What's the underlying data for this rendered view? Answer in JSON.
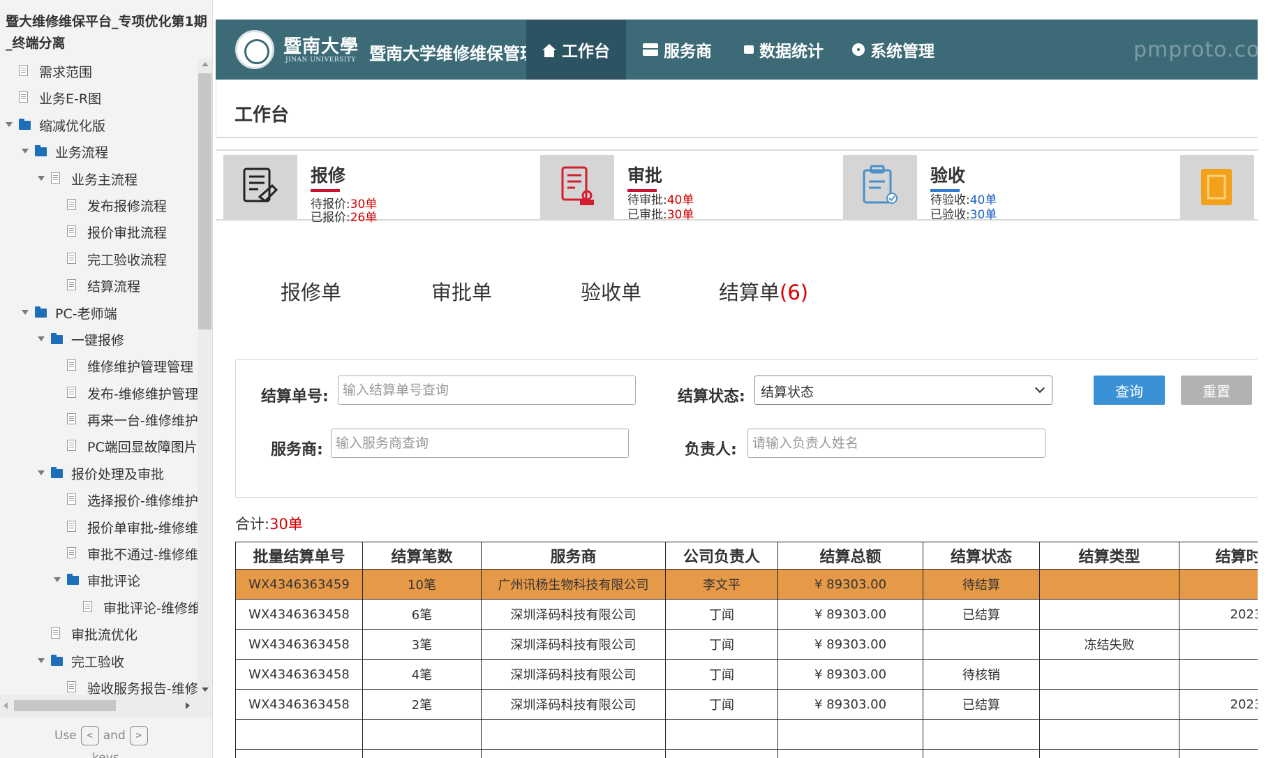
{
  "sidebar": {
    "title": "暨大维修维保平台_专项优化第1期_终端分离",
    "tree": [
      {
        "label": "需求范围",
        "type": "page",
        "level": 0,
        "toggle": false
      },
      {
        "label": "业务E-R图",
        "type": "page",
        "level": 0,
        "toggle": false
      },
      {
        "label": "缩减优化版",
        "type": "folder",
        "level": 0,
        "toggle": true
      },
      {
        "label": "业务流程",
        "type": "folder",
        "level": 1,
        "toggle": true
      },
      {
        "label": "业务主流程",
        "type": "page",
        "level": 2,
        "toggle": true
      },
      {
        "label": "发布报修流程",
        "type": "page",
        "level": 3,
        "toggle": false
      },
      {
        "label": "报价审批流程",
        "type": "page",
        "level": 3,
        "toggle": false
      },
      {
        "label": "完工验收流程",
        "type": "page",
        "level": 3,
        "toggle": false
      },
      {
        "label": "结算流程",
        "type": "page",
        "level": 3,
        "toggle": false
      },
      {
        "label": "PC-老师端",
        "type": "folder",
        "level": 1,
        "toggle": true
      },
      {
        "label": "一键报修",
        "type": "folder",
        "level": 2,
        "toggle": true
      },
      {
        "label": "维修维护管理管理",
        "type": "page",
        "level": 3,
        "toggle": false
      },
      {
        "label": "发布-维修维护管理",
        "type": "page",
        "level": 3,
        "toggle": false
      },
      {
        "label": "再来一台-维修维护",
        "type": "page",
        "level": 3,
        "toggle": false
      },
      {
        "label": "PC端回显故障图片",
        "type": "page",
        "level": 3,
        "toggle": false
      },
      {
        "label": "报价处理及审批",
        "type": "folder",
        "level": 2,
        "toggle": true
      },
      {
        "label": "选择报价-维修维护",
        "type": "page",
        "level": 3,
        "toggle": false
      },
      {
        "label": "报价单审批-维修维护",
        "type": "page",
        "level": 3,
        "toggle": false
      },
      {
        "label": "审批不通过-维修维护",
        "type": "page",
        "level": 3,
        "toggle": false
      },
      {
        "label": "审批评论",
        "type": "folder",
        "level": 3,
        "toggle": true
      },
      {
        "label": "审批评论-维修维护",
        "type": "page",
        "level": 4,
        "toggle": false
      },
      {
        "label": "审批流优化",
        "type": "page",
        "level": 2,
        "toggle": false
      },
      {
        "label": "完工验收",
        "type": "folder",
        "level": 2,
        "toggle": true
      },
      {
        "label": "验收服务报告-维修维护",
        "type": "page",
        "level": 3,
        "toggle": false
      }
    ],
    "hint_use": "Use",
    "hint_and": "and",
    "hint_key_left": "<",
    "hint_key_right": ">",
    "hint_keys": "keys"
  },
  "header": {
    "logo_cn": "暨南大學",
    "logo_en": "JINAN UNIVERSITY",
    "app_title": "暨南大学维修维保管理平台",
    "watermark": "pmproto.com 产品原型素材网站",
    "nav": [
      {
        "label": "工作台",
        "icon": "home-icon",
        "active": true
      },
      {
        "label": "服务商",
        "icon": "store-icon",
        "active": false
      },
      {
        "label": "数据统计",
        "icon": "chart-icon",
        "active": false
      },
      {
        "label": "系统管理",
        "icon": "gear-icon",
        "active": false
      }
    ]
  },
  "page_title": "工作台",
  "stats": [
    {
      "title": "报修",
      "icon": "repair-form-icon",
      "line1_label": "待报价:",
      "line1_value": "30单",
      "line2_label": "已报价:",
      "line2_value": "26单",
      "value_color": "#d40000"
    },
    {
      "title": "审批",
      "icon": "approval-document-icon",
      "line1_label": "待审批:",
      "line1_value": "40单",
      "line2_label": "已审批:",
      "line2_value": "30单",
      "value_color": "#d40000"
    },
    {
      "title": "验收",
      "icon": "clipboard-check-icon",
      "line1_label": "待验收:",
      "line1_value": "40单",
      "line2_label": "已验收:",
      "line2_value": "30单",
      "value_color": "#1e62c3"
    }
  ],
  "tabs": [
    {
      "label": "报修单",
      "count": ""
    },
    {
      "label": "审批单",
      "count": ""
    },
    {
      "label": "验收单",
      "count": ""
    },
    {
      "label": "结算单",
      "count": "(6)"
    }
  ],
  "filter": {
    "settlement_no_label": "结算单号:",
    "settlement_no_placeholder": "输入结算单号查询",
    "status_label": "结算状态:",
    "status_value": "结算状态",
    "vendor_label": "服务商:",
    "vendor_placeholder": "输入服务商查询",
    "owner_label": "负责人:",
    "owner_placeholder": "请输入负责人姓名",
    "query_label": "查询",
    "reset_label": "重置"
  },
  "summary": {
    "label": "合计:",
    "value": "30单"
  },
  "table": {
    "columns": [
      "批量结算单号",
      "结算笔数",
      "服务商",
      "公司负责人",
      "结算总额",
      "结算状态",
      "结算类型",
      "结算时间"
    ],
    "rows": [
      {
        "cells": [
          "WX4346363459",
          "10笔",
          "广州讯杨生物科技有限公司",
          "李文平",
          "¥ 89303.00",
          "待结算",
          "",
          ""
        ],
        "highlight": true
      },
      {
        "cells": [
          "WX4346363458",
          "6笔",
          "深圳泽码科技有限公司",
          "丁闻",
          "¥ 89303.00",
          "已结算",
          "",
          "2023"
        ],
        "highlight": false
      },
      {
        "cells": [
          "WX4346363458",
          "3笔",
          "深圳泽码科技有限公司",
          "丁闻",
          "¥ 89303.00",
          "",
          "冻结失败",
          ""
        ],
        "highlight": false
      },
      {
        "cells": [
          "WX4346363458",
          "4笔",
          "深圳泽码科技有限公司",
          "丁闻",
          "¥ 89303.00",
          "待核销",
          "",
          ""
        ],
        "highlight": false
      },
      {
        "cells": [
          "WX4346363458",
          "2笔",
          "深圳泽码科技有限公司",
          "丁闻",
          "¥ 89303.00",
          "已结算",
          "",
          "2023"
        ],
        "highlight": false
      },
      {
        "cells": [
          "",
          "",
          "",
          "",
          "",
          "",
          "",
          ""
        ],
        "highlight": false
      },
      {
        "cells": [
          "",
          "",
          "",
          "",
          "",
          "",
          "",
          ""
        ],
        "highlight": false
      }
    ]
  },
  "colors": {
    "header_bg": "#3c6b77",
    "nav_active_bg": "#2c5361",
    "highlight_row": "#e69a48",
    "query_button": "#3b91d6",
    "reset_button": "#b2b2b2",
    "count_red": "#d40000",
    "count_blue": "#1e62c3"
  }
}
